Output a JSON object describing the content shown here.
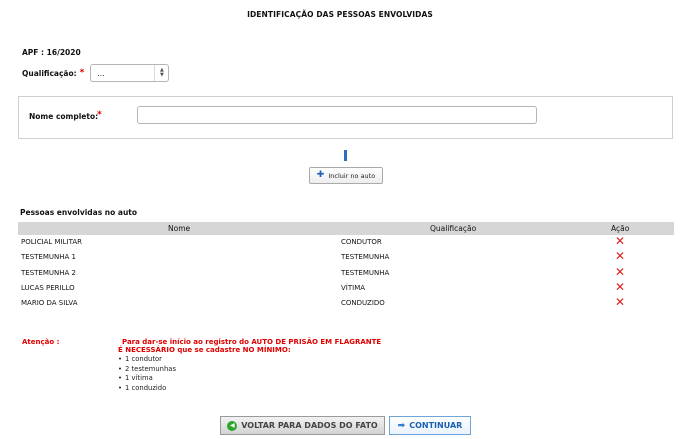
{
  "page_title": "IDENTIFICAÇÃO DAS PESSOAS ENVOLVIDAS",
  "apf": "APF : 16/2020",
  "qualificacao": {
    "label": "Qualificação:",
    "required_mark": "*",
    "value": "..."
  },
  "nome_completo": {
    "label": "Nome completo:",
    "required_mark": "*",
    "value": ""
  },
  "incluir_button": {
    "icon": "plus-icon",
    "label": "Incluir no auto"
  },
  "section_title": "Pessoas envolvidas no auto",
  "table": {
    "headers": [
      "Nome",
      "Qualificação",
      "Ação"
    ],
    "rows": [
      {
        "nome": "POLICIAL MILITAR",
        "qualificacao": "CONDUTOR",
        "acao": "✕"
      },
      {
        "nome": "TESTEMUNHA 1",
        "qualificacao": "TESTEMUNHA",
        "acao": "✕"
      },
      {
        "nome": "TESTEMUNHA 2",
        "qualificacao": "TESTEMUNHA",
        "acao": "✕"
      },
      {
        "nome": "LUCAS PERILLO",
        "qualificacao": "VÍTIMA",
        "acao": "✕"
      },
      {
        "nome": "MARIO DA SILVA",
        "qualificacao": "CONDUZIDO",
        "acao": "✕"
      }
    ]
  },
  "atencao": {
    "label": "Atenção :",
    "line1": "Para dar-se início ao registro do AUTO DE PRISÃO EM FLAGRANTE",
    "line2": "É NECESSÁRIO que se cadastre NO MÍNIMO:",
    "items": [
      "1 condutor",
      "2 testemunhas",
      "1 vítima",
      "1 conduzido"
    ]
  },
  "buttons": {
    "voltar": "VOLTAR PARA DADOS DO FATO",
    "continuar": "CONTINUAR"
  },
  "colors": {
    "required": "#e00000",
    "accent": "#1a5fb0",
    "delete": "#e02020"
  }
}
